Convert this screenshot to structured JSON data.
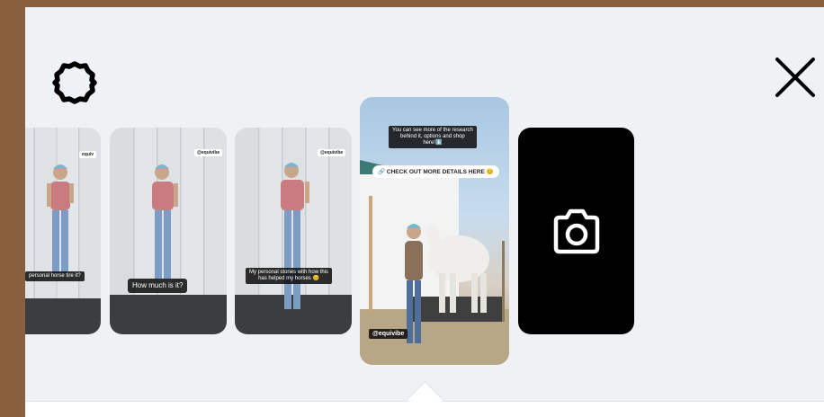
{
  "header": {
    "settings_icon": "gear-icon",
    "close_icon": "close-icon"
  },
  "stories": [
    {
      "handle": "equiv",
      "caption": "personal horse tire it?"
    },
    {
      "handle": "@equivibe",
      "caption": "How much is it?"
    },
    {
      "handle": "@equivibe",
      "caption_line1": "My personal stories with how this",
      "caption_line2": "has helped my horses 😊"
    },
    {
      "caption_line1": "You can see more of the research",
      "caption_line2": "behind it, options and shop",
      "caption_line3": "here!⬇️",
      "link": "🔗 CHECK OUT MORE DETAILS HERE 😊",
      "handle": "@equivibe"
    }
  ],
  "camera": {
    "icon": "camera-icon"
  },
  "colors": {
    "frame": "#8a5f3e",
    "panel": "#eef2f4",
    "camera_card": "#000000"
  }
}
